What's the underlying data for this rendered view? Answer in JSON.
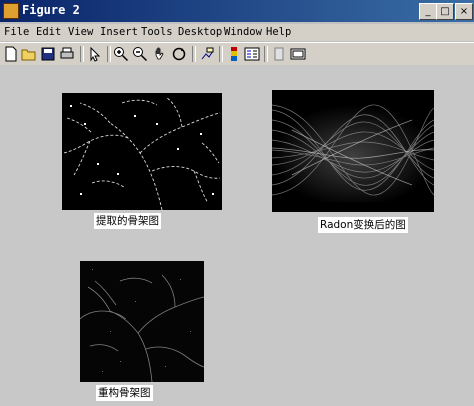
{
  "window": {
    "title": "Figure 2"
  },
  "title_buttons": {
    "minimize": "_",
    "maximize": "□",
    "close": "×"
  },
  "menu": [
    "File",
    "Edit",
    "View",
    "Insert",
    "Tools",
    "Desktop",
    "Window",
    "Help"
  ],
  "toolbar": [
    "new-figure",
    "open-file",
    "save",
    "print",
    "select",
    "zoom-in",
    "zoom-out",
    "pan",
    "rotate-3d",
    "data-cursor",
    "colorbar",
    "legend",
    "hide-plot-tools",
    "show-plot-tools"
  ],
  "subplots": {
    "skeleton": {
      "caption": "提取的骨架图"
    },
    "radon": {
      "caption": "Radon变换后的图"
    },
    "reconstruct": {
      "caption": "重构骨架图"
    }
  }
}
